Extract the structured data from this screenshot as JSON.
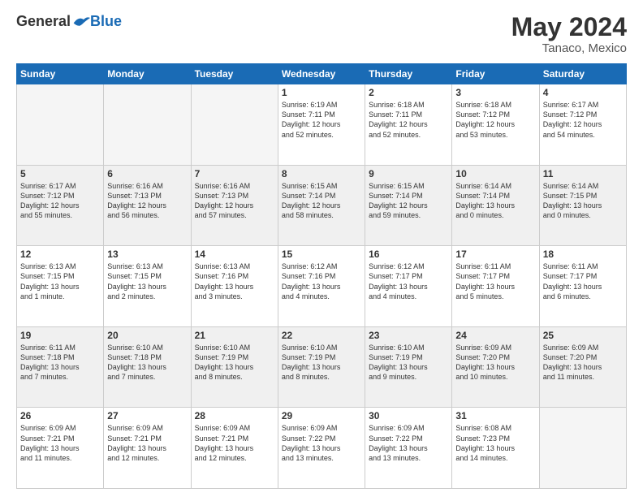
{
  "header": {
    "logo_general": "General",
    "logo_blue": "Blue",
    "month": "May 2024",
    "location": "Tanaco, Mexico"
  },
  "weekdays": [
    "Sunday",
    "Monday",
    "Tuesday",
    "Wednesday",
    "Thursday",
    "Friday",
    "Saturday"
  ],
  "weeks": [
    [
      {
        "day": "",
        "text": "",
        "empty": true
      },
      {
        "day": "",
        "text": "",
        "empty": true
      },
      {
        "day": "",
        "text": "",
        "empty": true
      },
      {
        "day": "1",
        "text": "Sunrise: 6:19 AM\nSunset: 7:11 PM\nDaylight: 12 hours\nand 52 minutes."
      },
      {
        "day": "2",
        "text": "Sunrise: 6:18 AM\nSunset: 7:11 PM\nDaylight: 12 hours\nand 52 minutes."
      },
      {
        "day": "3",
        "text": "Sunrise: 6:18 AM\nSunset: 7:12 PM\nDaylight: 12 hours\nand 53 minutes."
      },
      {
        "day": "4",
        "text": "Sunrise: 6:17 AM\nSunset: 7:12 PM\nDaylight: 12 hours\nand 54 minutes."
      }
    ],
    [
      {
        "day": "5",
        "text": "Sunrise: 6:17 AM\nSunset: 7:12 PM\nDaylight: 12 hours\nand 55 minutes."
      },
      {
        "day": "6",
        "text": "Sunrise: 6:16 AM\nSunset: 7:13 PM\nDaylight: 12 hours\nand 56 minutes."
      },
      {
        "day": "7",
        "text": "Sunrise: 6:16 AM\nSunset: 7:13 PM\nDaylight: 12 hours\nand 57 minutes."
      },
      {
        "day": "8",
        "text": "Sunrise: 6:15 AM\nSunset: 7:14 PM\nDaylight: 12 hours\nand 58 minutes."
      },
      {
        "day": "9",
        "text": "Sunrise: 6:15 AM\nSunset: 7:14 PM\nDaylight: 12 hours\nand 59 minutes."
      },
      {
        "day": "10",
        "text": "Sunrise: 6:14 AM\nSunset: 7:14 PM\nDaylight: 13 hours\nand 0 minutes."
      },
      {
        "day": "11",
        "text": "Sunrise: 6:14 AM\nSunset: 7:15 PM\nDaylight: 13 hours\nand 0 minutes."
      }
    ],
    [
      {
        "day": "12",
        "text": "Sunrise: 6:13 AM\nSunset: 7:15 PM\nDaylight: 13 hours\nand 1 minute."
      },
      {
        "day": "13",
        "text": "Sunrise: 6:13 AM\nSunset: 7:15 PM\nDaylight: 13 hours\nand 2 minutes."
      },
      {
        "day": "14",
        "text": "Sunrise: 6:13 AM\nSunset: 7:16 PM\nDaylight: 13 hours\nand 3 minutes."
      },
      {
        "day": "15",
        "text": "Sunrise: 6:12 AM\nSunset: 7:16 PM\nDaylight: 13 hours\nand 4 minutes."
      },
      {
        "day": "16",
        "text": "Sunrise: 6:12 AM\nSunset: 7:17 PM\nDaylight: 13 hours\nand 4 minutes."
      },
      {
        "day": "17",
        "text": "Sunrise: 6:11 AM\nSunset: 7:17 PM\nDaylight: 13 hours\nand 5 minutes."
      },
      {
        "day": "18",
        "text": "Sunrise: 6:11 AM\nSunset: 7:17 PM\nDaylight: 13 hours\nand 6 minutes."
      }
    ],
    [
      {
        "day": "19",
        "text": "Sunrise: 6:11 AM\nSunset: 7:18 PM\nDaylight: 13 hours\nand 7 minutes."
      },
      {
        "day": "20",
        "text": "Sunrise: 6:10 AM\nSunset: 7:18 PM\nDaylight: 13 hours\nand 7 minutes."
      },
      {
        "day": "21",
        "text": "Sunrise: 6:10 AM\nSunset: 7:19 PM\nDaylight: 13 hours\nand 8 minutes."
      },
      {
        "day": "22",
        "text": "Sunrise: 6:10 AM\nSunset: 7:19 PM\nDaylight: 13 hours\nand 8 minutes."
      },
      {
        "day": "23",
        "text": "Sunrise: 6:10 AM\nSunset: 7:19 PM\nDaylight: 13 hours\nand 9 minutes."
      },
      {
        "day": "24",
        "text": "Sunrise: 6:09 AM\nSunset: 7:20 PM\nDaylight: 13 hours\nand 10 minutes."
      },
      {
        "day": "25",
        "text": "Sunrise: 6:09 AM\nSunset: 7:20 PM\nDaylight: 13 hours\nand 11 minutes."
      }
    ],
    [
      {
        "day": "26",
        "text": "Sunrise: 6:09 AM\nSunset: 7:21 PM\nDaylight: 13 hours\nand 11 minutes."
      },
      {
        "day": "27",
        "text": "Sunrise: 6:09 AM\nSunset: 7:21 PM\nDaylight: 13 hours\nand 12 minutes."
      },
      {
        "day": "28",
        "text": "Sunrise: 6:09 AM\nSunset: 7:21 PM\nDaylight: 13 hours\nand 12 minutes."
      },
      {
        "day": "29",
        "text": "Sunrise: 6:09 AM\nSunset: 7:22 PM\nDaylight: 13 hours\nand 13 minutes."
      },
      {
        "day": "30",
        "text": "Sunrise: 6:09 AM\nSunset: 7:22 PM\nDaylight: 13 hours\nand 13 minutes."
      },
      {
        "day": "31",
        "text": "Sunrise: 6:08 AM\nSunset: 7:23 PM\nDaylight: 13 hours\nand 14 minutes."
      },
      {
        "day": "",
        "text": "",
        "empty": true
      }
    ]
  ]
}
